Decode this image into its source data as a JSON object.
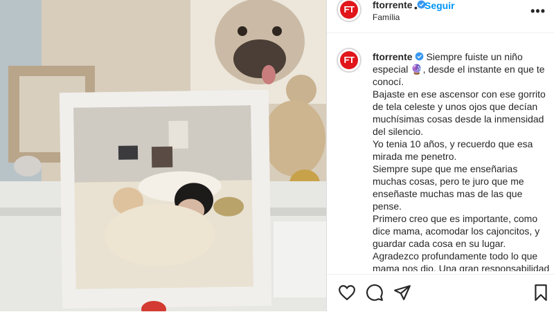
{
  "post": {
    "username": "ftorrente",
    "follow_label": "Seguir",
    "separator": "•",
    "subtitle": "Família",
    "avatar_text": "FT",
    "more_label": "•••"
  },
  "caption": {
    "username": "ftorrente",
    "emoji": "🔮",
    "lines": [
      "Siempre fuiste un niño especial 🔮, desde el instante en que te conocí.",
      "Bajaste en ese ascensor con ese gorrito de tela celeste y unos ojos que decían muchísimas cosas desde la inmensidad del silencio.",
      "Yo tenia 10 años, y recuerdo que esa mirada me penetro.",
      "Siempre supe que me enseñarias muchas cosas, pero te juro que me enseñaste muchas mas de las que pense.",
      "Primero creo que es importante, como dice mama, acomodar los cajoncitos, y guardar cada cosa en su lugar.",
      "Agradezco profundamente todo lo que mama nos dio. Una gran responsabilidad y una gran enseñanza: Ser valientes."
    ]
  },
  "actions": [
    "heart-icon",
    "comment-icon",
    "share-icon",
    "bookmark-icon"
  ],
  "colors": {
    "accent": "#0095f6",
    "brand": "#e0161b",
    "verified": "#3897f0"
  }
}
